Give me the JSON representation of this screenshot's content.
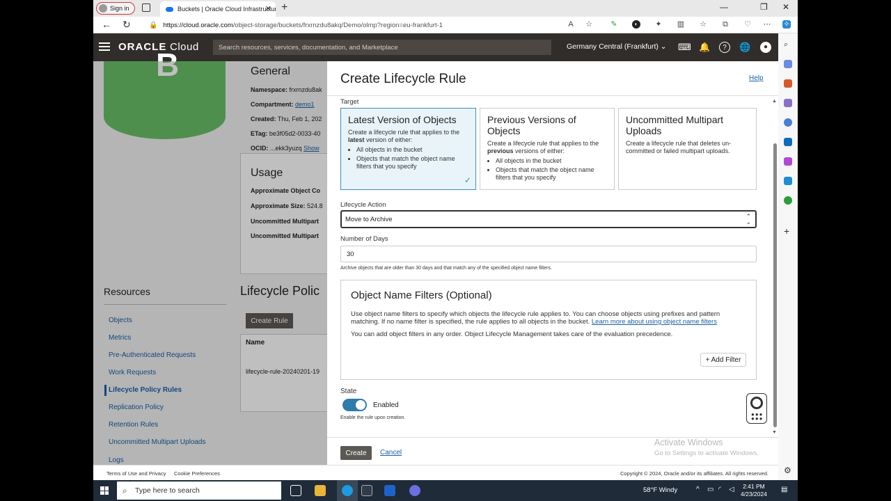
{
  "browser": {
    "signin_label": "Sign in",
    "tab_title": "Buckets | Oracle Cloud Infrastructure",
    "url_host": "https://cloud.oracle.com",
    "url_path": "/object-storage/buckets/frxrnzdu8akq/Demo/olmp?region=eu-frankfurt-1"
  },
  "oci": {
    "logo_bold": "ORACLE",
    "logo_rest": "Cloud",
    "search_placeholder": "Search resources, services, documentation, and Marketplace",
    "region": "Germany Central (Frankfurt)"
  },
  "bucket": {
    "letter": "B",
    "general_title": "General",
    "namespace_label": "Namespace:",
    "namespace_value": "frxrnzdu8ak",
    "compartment_label": "Compartment:",
    "compartment_value": "demo1",
    "created_label": "Created:",
    "created_value": "Thu, Feb 1, 202",
    "etag_label": "ETag:",
    "etag_value": "be3f05d2-0033-40",
    "ocid_label": "OCID:",
    "ocid_value": "...ekk3yuzq",
    "ocid_show": "Show",
    "usage_title": "Usage",
    "usage_rows": [
      "Approximate Object Co",
      "Approximate Size:",
      "Uncommitted Multipart",
      "Uncommitted Multipart"
    ],
    "usage_size_value": "524.8"
  },
  "resources": {
    "title": "Resources",
    "items": [
      "Objects",
      "Metrics",
      "Pre-Authenticated Requests",
      "Work Requests",
      "Lifecycle Policy Rules",
      "Replication Policy",
      "Retention Rules",
      "Uncommitted Multipart Uploads",
      "Logs"
    ]
  },
  "lifecycle": {
    "title": "Lifecycle Polic",
    "create_rule": "Create Rule",
    "col_name": "Name",
    "row_name": "lifecycle-rule-20240201-19"
  },
  "panel": {
    "title": "Create Lifecycle Rule",
    "help": "Help",
    "target_label": "Target",
    "cards": [
      {
        "title": "Latest Version of Objects",
        "desc_pre": "Create a lifecycle rule that applies to the ",
        "desc_bold": "latest",
        "desc_post": " version of either:",
        "items": [
          "All objects in the bucket",
          "Objects that match the object name filters that you specify"
        ]
      },
      {
        "title": "Previous Versions of Objects",
        "desc_pre": "Create a lifecycle rule that applies to the ",
        "desc_bold": "previous",
        "desc_post": " versions of either:",
        "items": [
          "All objects in the bucket",
          "Objects that match the object name filters that you specify"
        ]
      },
      {
        "title": "Uncommitted Multipart Uploads",
        "desc": "Create a lifecycle rule that deletes un-committed or failed multipart uploads."
      }
    ],
    "action_label": "Lifecycle Action",
    "action_value": "Move to Archive",
    "days_label": "Number of Days",
    "days_value": "30",
    "days_hint": "Archive objects that are older than 30 days and that match any of the specified object name filters.",
    "filters_title": "Object Name Filters  (Optional)",
    "filters_desc": "Use object name filters to specify which objects the lifecycle rule applies to. You can choose objects using prefixes and pattern matching. If no name filter is specified, the rule applies to all objects in the bucket. ",
    "filters_link": "Learn more about using object name filters",
    "filters_desc2": "You can add object filters in any order. Object Lifecycle Management takes care of the evaluation precedence.",
    "add_filter": "+ Add Filter",
    "state_label": "State",
    "state_value": "Enabled",
    "state_hint": "Enable the rule upon creation.",
    "create_button": "Create",
    "cancel_button": "Cancel"
  },
  "watermark": {
    "line1": "Activate Windows",
    "line2": "Go to Settings to activate Windows."
  },
  "footer": {
    "terms": "Terms of Use and Privacy",
    "cookies": "Cookie Preferences",
    "copyright": "Copyright © 2024, Oracle and/or its affiliates. All rights reserved."
  },
  "taskbar": {
    "search_placeholder": "Type here to search",
    "weather": "58°F  Windy",
    "time": "2:41 PM",
    "date": "4/23/2024"
  },
  "colors": {
    "oci_header": "#312d2a",
    "accent_blue": "#1a5fa3",
    "bucket_green": "#6abf69",
    "selected_card": "#e8f4fa",
    "toggle": "#2e7bad"
  }
}
